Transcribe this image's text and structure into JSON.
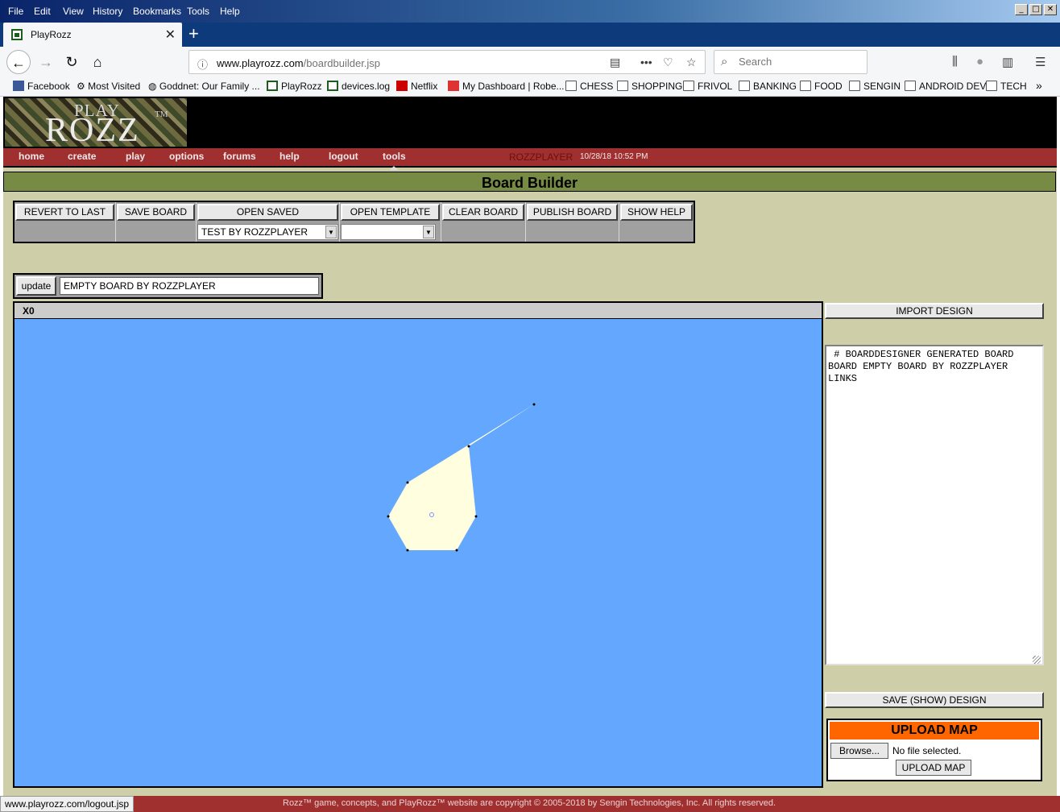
{
  "browser": {
    "menu": [
      "File",
      "Edit",
      "View",
      "History",
      "Bookmarks",
      "Tools",
      "Help"
    ],
    "window_buttons": [
      "_",
      "□",
      "✕"
    ],
    "tab_title": "PlayRozz",
    "url_domain": "www.playrozz.com",
    "url_path": "/boardbuilder.jsp",
    "search_placeholder": "Search",
    "bookmarks": [
      {
        "label": "Facebook",
        "icon": "facebook-icon"
      },
      {
        "label": "Most Visited",
        "icon": "gear-icon"
      },
      {
        "label": "Goddnet: Our Family ...",
        "icon": "globe-icon"
      },
      {
        "label": "PlayRozz",
        "icon": "playrozz-icon"
      },
      {
        "label": "devices.log",
        "icon": "playrozz-icon"
      },
      {
        "label": "Netflix",
        "icon": "netflix-icon"
      },
      {
        "label": "My Dashboard | Robe...",
        "icon": "dashboard-icon"
      },
      {
        "label": "CHESS",
        "icon": "folder-icon"
      },
      {
        "label": "SHOPPING",
        "icon": "folder-icon"
      },
      {
        "label": "FRIVOL",
        "icon": "folder-icon"
      },
      {
        "label": "BANKING",
        "icon": "folder-icon"
      },
      {
        "label": "FOOD",
        "icon": "folder-icon"
      },
      {
        "label": "SENGIN",
        "icon": "folder-icon"
      },
      {
        "label": "ANDROID DEV",
        "icon": "folder-icon"
      },
      {
        "label": "TECH",
        "icon": "folder-icon"
      }
    ]
  },
  "site": {
    "logo_play": "PLAY",
    "logo_rozz": "ROZZ",
    "logo_tm": "TM",
    "nav": [
      "home",
      "create",
      "play",
      "options",
      "forums",
      "help",
      "logout",
      "tools"
    ],
    "username": "ROZZPLAYER",
    "timestamp": "10/28/18 10:52 PM",
    "page_title": "Board Builder"
  },
  "toolbar": {
    "buttons": [
      "REVERT TO LAST",
      "SAVE BOARD",
      "OPEN SAVED",
      "OPEN TEMPLATE",
      "CLEAR BOARD",
      "PUBLISH BOARD",
      "SHOW HELP"
    ],
    "open_saved_value": "TEST BY ROZZPLAYER",
    "open_template_value": ""
  },
  "board": {
    "update_label": "update",
    "name_value": "EMPTY BOARD BY ROZZPLAYER",
    "canvas_label": "X0",
    "colors": {
      "water": "#63a8fe",
      "land": "#ffffe0"
    }
  },
  "panel": {
    "import_label": "IMPORT DESIGN",
    "design_text": " # BOARDDESIGNER GENERATED BOARD\nBOARD EMPTY BOARD BY ROZZPLAYER\nLINKS",
    "save_label": "SAVE (SHOW) DESIGN",
    "upload_header": "UPLOAD MAP",
    "browse_label": "Browse...",
    "file_status": "No file selected.",
    "upload_button": "UPLOAD MAP"
  },
  "status": {
    "url": "www.playrozz.com/logout.jsp",
    "copyright": "Rozz™ game, concepts, and PlayRozz™ website are copyright © 2005-2018 by Sengin Technologies, Inc. All rights reserved."
  }
}
